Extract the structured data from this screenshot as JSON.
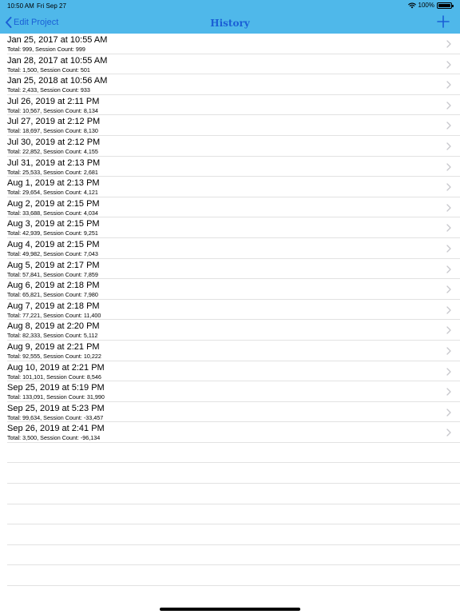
{
  "status_bar": {
    "time": "10:50 AM",
    "date": "Fri Sep 27",
    "battery": "100%"
  },
  "nav": {
    "back_label": "Edit Project",
    "title": "History",
    "add_icon": "plus-icon"
  },
  "history": [
    {
      "title": "Jan 25, 2017 at 10:55 AM",
      "subtitle": "Total: 999, Session Count: 999"
    },
    {
      "title": "Jan 28, 2017 at 10:55 AM",
      "subtitle": "Total: 1,500, Session Count: 501"
    },
    {
      "title": "Jan 25, 2018 at 10:56 AM",
      "subtitle": "Total: 2,433, Session Count: 933"
    },
    {
      "title": "Jul 26, 2019 at 2:11 PM",
      "subtitle": "Total: 10,567, Session Count: 8,134"
    },
    {
      "title": "Jul 27, 2019 at 2:12 PM",
      "subtitle": "Total: 18,697, Session Count: 8,130"
    },
    {
      "title": "Jul 30, 2019 at 2:12 PM",
      "subtitle": "Total: 22,852, Session Count: 4,155"
    },
    {
      "title": "Jul 31, 2019 at 2:13 PM",
      "subtitle": "Total: 25,533, Session Count: 2,681"
    },
    {
      "title": "Aug 1, 2019 at 2:13 PM",
      "subtitle": "Total: 29,654, Session Count: 4,121"
    },
    {
      "title": "Aug 2, 2019 at 2:15 PM",
      "subtitle": "Total: 33,688, Session Count: 4,034"
    },
    {
      "title": "Aug 3, 2019 at 2:15 PM",
      "subtitle": "Total: 42,939, Session Count: 9,251"
    },
    {
      "title": "Aug 4, 2019 at 2:15 PM",
      "subtitle": "Total: 49,982, Session Count: 7,043"
    },
    {
      "title": "Aug 5, 2019 at 2:17 PM",
      "subtitle": "Total: 57,841, Session Count: 7,859"
    },
    {
      "title": "Aug 6, 2019 at 2:18 PM",
      "subtitle": "Total: 65,821, Session Count: 7,980"
    },
    {
      "title": "Aug 7, 2019 at 2:18 PM",
      "subtitle": "Total: 77,221, Session Count: 11,400"
    },
    {
      "title": "Aug 8, 2019 at 2:20 PM",
      "subtitle": "Total: 82,333, Session Count: 5,112"
    },
    {
      "title": "Aug 9, 2019 at 2:21 PM",
      "subtitle": "Total: 92,555, Session Count: 10,222"
    },
    {
      "title": "Aug 10, 2019 at 2:21 PM",
      "subtitle": "Total: 101,101, Session Count: 8,546"
    },
    {
      "title": "Sep 25, 2019 at 5:19 PM",
      "subtitle": "Total: 133,091, Session Count: 31,990"
    },
    {
      "title": "Sep 25, 2019 at 5:23 PM",
      "subtitle": "Total: 99,634, Session Count: -33,457"
    },
    {
      "title": "Sep 26, 2019 at 2:41 PM",
      "subtitle": "Total: 3,500, Session Count: -96,134"
    }
  ],
  "colors": {
    "header": "#4fb8ea",
    "accent": "#1a5fd6",
    "separator": "#e2e2e2",
    "chevron": "#c7c7cc"
  }
}
